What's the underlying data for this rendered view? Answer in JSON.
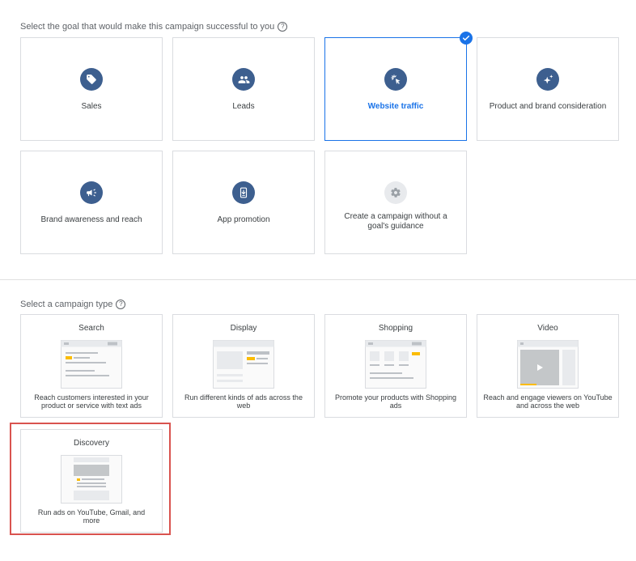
{
  "goals": {
    "prompt": "Select the goal that would make this campaign successful to you",
    "help_icon": "help-circle-icon",
    "items": [
      {
        "label": "Sales",
        "icon": "tag-icon"
      },
      {
        "label": "Leads",
        "icon": "people-icon"
      },
      {
        "label": "Website traffic",
        "icon": "cursor-click-icon",
        "selected": true
      },
      {
        "label": "Product and brand consideration",
        "icon": "sparkle-icon"
      },
      {
        "label": "Brand awareness and reach",
        "icon": "megaphone-icon"
      },
      {
        "label": "App promotion",
        "icon": "phone-download-icon"
      },
      {
        "label": "Create a campaign without a goal's guidance",
        "icon": "gear-icon"
      }
    ]
  },
  "campaign_types": {
    "prompt": "Select a campaign type",
    "items": [
      {
        "title": "Search",
        "desc": "Reach customers interested in your product or service with text ads"
      },
      {
        "title": "Display",
        "desc": "Run different kinds of ads across the web"
      },
      {
        "title": "Shopping",
        "desc": "Promote your products with Shopping ads"
      },
      {
        "title": "Video",
        "desc": "Reach and engage viewers on YouTube and across the web"
      },
      {
        "title": "Discovery",
        "desc": "Run ads on YouTube, Gmail, and more",
        "highlighted": true
      }
    ]
  },
  "colors": {
    "accent": "#1a73e8",
    "goal_icon_bg": "#3d5f8f",
    "highlight_border": "#d9534f",
    "ad_yellow": "#fbbc04"
  }
}
